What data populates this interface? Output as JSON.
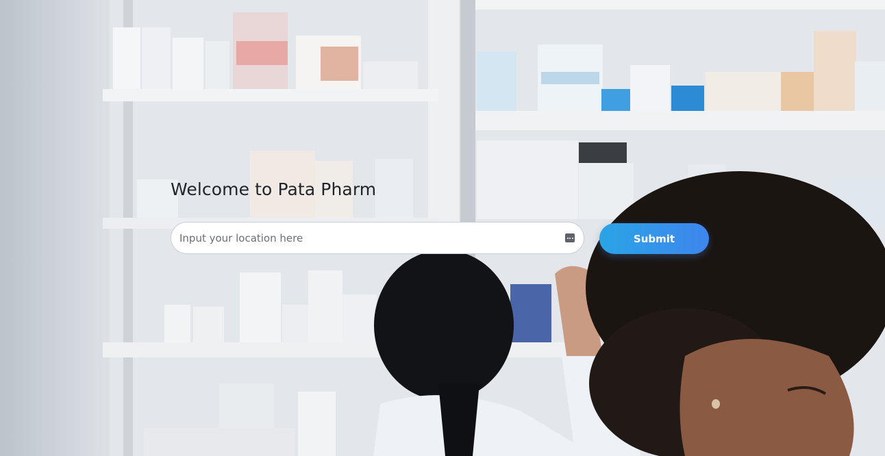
{
  "hero": {
    "heading": "Welcome to Pata Pharm",
    "search": {
      "placeholder": "Input your location here",
      "value": ""
    },
    "submit_label": "Submit",
    "background_image": "pharmacy-shelves-pharmacists-photo"
  },
  "colors": {
    "button_gradient_start": "#2aa4e6",
    "button_gradient_end": "#3e86ec",
    "heading": "#22252b"
  }
}
